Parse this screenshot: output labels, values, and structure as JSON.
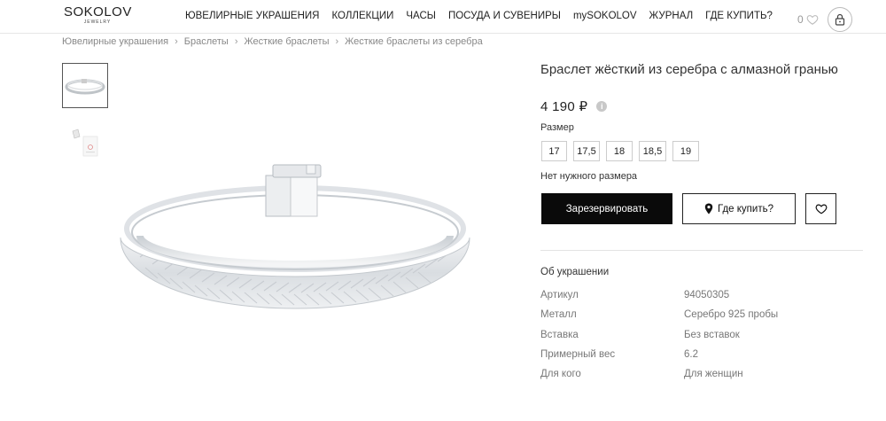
{
  "logo": {
    "main": "SOKOLOV",
    "sub": "JEWELRY"
  },
  "nav": [
    "ЮВЕЛИРНЫЕ УКРАШЕНИЯ",
    "КОЛЛЕКЦИИ",
    "ЧАСЫ",
    "ПОСУДА И СУВЕНИРЫ",
    "mySOKOLOV",
    "ЖУРНАЛ",
    "ГДЕ КУПИТЬ?"
  ],
  "header": {
    "favorites_count": "0"
  },
  "breadcrumb": [
    "Ювелирные украшения",
    "Браслеты",
    "Жесткие браслеты",
    "Жесткие браслеты из серебра"
  ],
  "product": {
    "title": "Браслет жёсткий из серебра с алмазной гранью",
    "price": "4 190 ₽",
    "size_label": "Размер",
    "sizes": [
      "17",
      "17,5",
      "18",
      "18,5",
      "19"
    ],
    "no_size": "Нет нужного размера",
    "reserve_label": "Зарезервировать",
    "where_label": "Где купить?"
  },
  "about": {
    "title": "Об украшении",
    "specs": [
      {
        "key": "Артикул",
        "value": "94050305"
      },
      {
        "key": "Металл",
        "value": "Серебро 925 пробы"
      },
      {
        "key": "Вставка",
        "value": "Без вставок"
      },
      {
        "key": "Примерный вес",
        "value": "6.2"
      },
      {
        "key": "Для кого",
        "value": "Для женщин"
      }
    ]
  }
}
